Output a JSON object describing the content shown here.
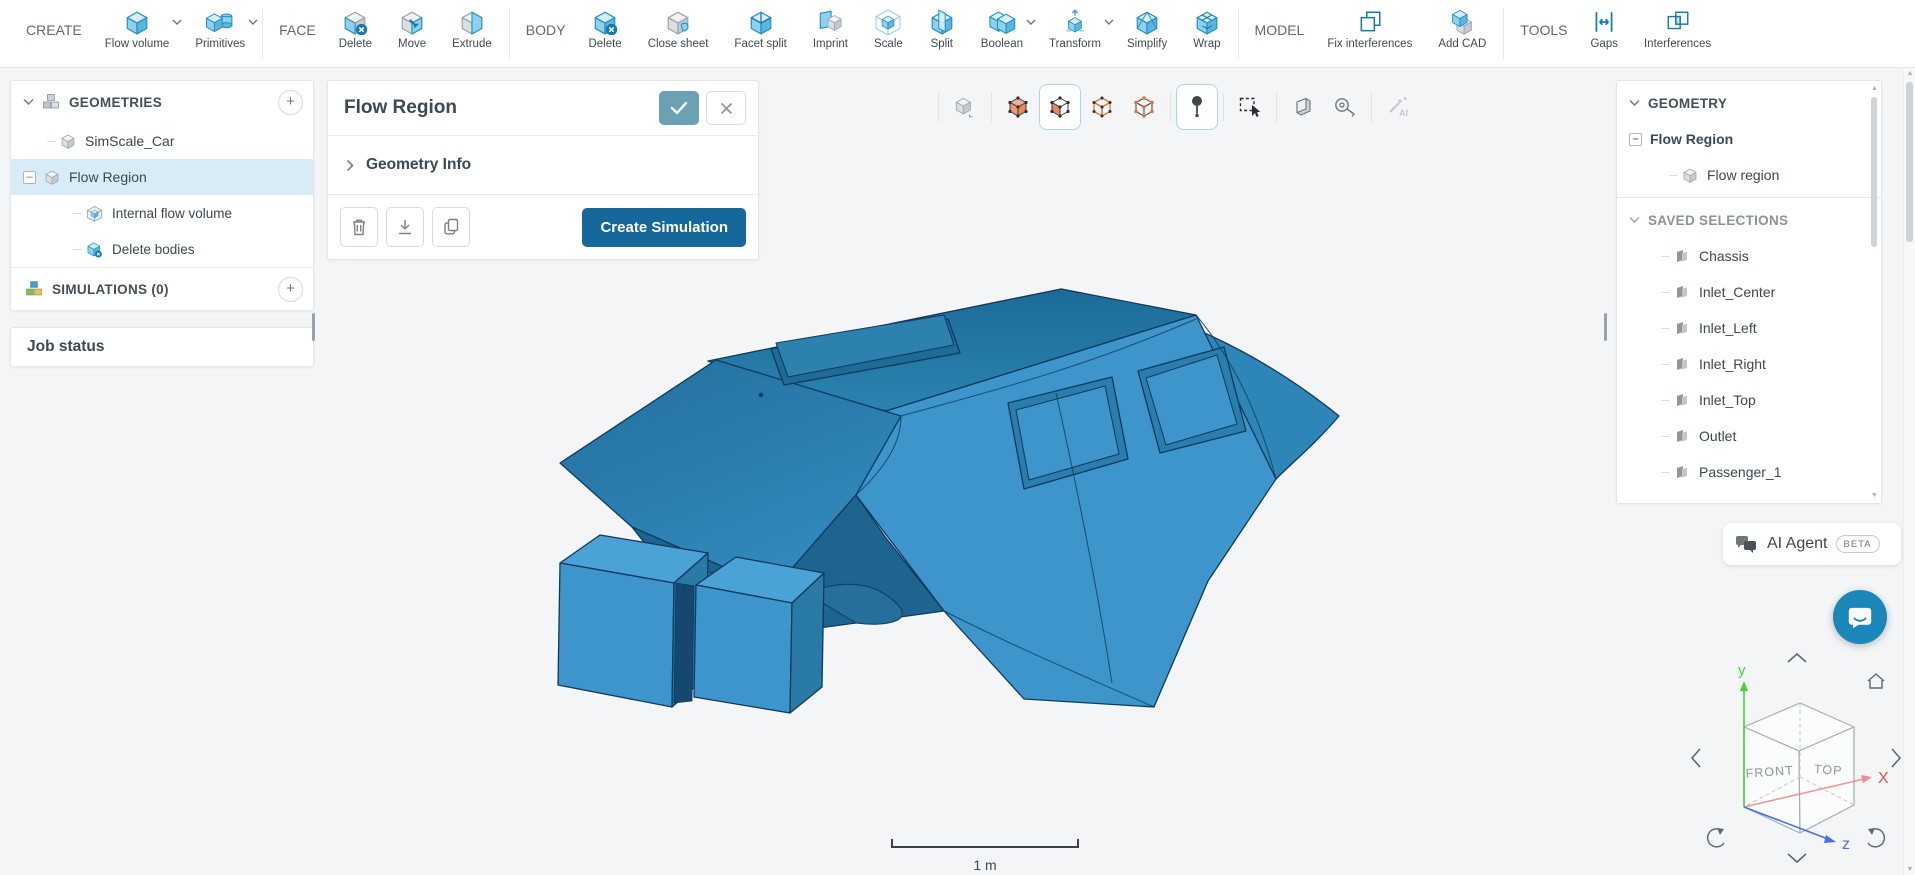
{
  "toolbar": {
    "create": {
      "label": "CREATE",
      "items": [
        {
          "label": "Flow volume",
          "icon": "flow-volume-icon",
          "dropdown": true
        },
        {
          "label": "Primitives",
          "icon": "primitives-icon",
          "dropdown": true
        }
      ]
    },
    "face": {
      "label": "FACE",
      "items": [
        {
          "label": "Delete",
          "icon": "face-delete-icon"
        },
        {
          "label": "Move",
          "icon": "face-move-icon"
        },
        {
          "label": "Extrude",
          "icon": "face-extrude-icon"
        }
      ]
    },
    "body": {
      "label": "BODY",
      "items": [
        {
          "label": "Delete",
          "icon": "body-delete-icon"
        },
        {
          "label": "Close sheet",
          "icon": "close-sheet-icon"
        },
        {
          "label": "Facet split",
          "icon": "facet-split-icon"
        },
        {
          "label": "Imprint",
          "icon": "imprint-icon"
        },
        {
          "label": "Scale",
          "icon": "scale-icon"
        },
        {
          "label": "Split",
          "icon": "split-icon"
        },
        {
          "label": "Boolean",
          "icon": "boolean-icon",
          "dropdown": true
        },
        {
          "label": "Transform",
          "icon": "transform-icon",
          "dropdown": true
        },
        {
          "label": "Simplify",
          "icon": "simplify-icon"
        },
        {
          "label": "Wrap",
          "icon": "wrap-icon"
        }
      ]
    },
    "model": {
      "label": "MODEL",
      "items": [
        {
          "label": "Fix interferences",
          "icon": "fix-interferences-icon"
        },
        {
          "label": "Add CAD",
          "icon": "add-cad-icon"
        }
      ]
    },
    "tools": {
      "label": "TOOLS",
      "items": [
        {
          "label": "Gaps",
          "icon": "gaps-icon"
        },
        {
          "label": "Interferences",
          "icon": "interferences-icon"
        }
      ]
    }
  },
  "left_panel": {
    "geometries": {
      "label": "GEOMETRIES",
      "items": [
        {
          "label": "SimScale_Car"
        },
        {
          "label": "Flow Region",
          "selected": true,
          "children": [
            {
              "label": "Internal flow volume",
              "icon": "flow-volume-cube-icon"
            },
            {
              "label": "Delete bodies",
              "icon": "delete-cube-icon"
            }
          ]
        }
      ]
    },
    "simulations": {
      "label": "SIMULATIONS (0)"
    },
    "job_status": {
      "label": "Job status"
    }
  },
  "detail_panel": {
    "title": "Flow Region",
    "sections": [
      {
        "label": "Geometry Info"
      }
    ],
    "actions": {
      "create_simulation": "Create Simulation"
    }
  },
  "viewport": {
    "scale_bar": {
      "label": "1 m"
    },
    "nav_cube": {
      "faces": {
        "left": "FRONT",
        "right": "TOP"
      },
      "axes": {
        "x": "X",
        "y": "y",
        "z": "z"
      }
    },
    "tool_modes": {
      "active": [
        "face-select",
        "probe-point"
      ]
    }
  },
  "right_panel": {
    "geometry": {
      "label": "GEOMETRY",
      "root": {
        "label": "Flow Region"
      },
      "child": {
        "label": "Flow region"
      }
    },
    "saved_selections": {
      "label": "SAVED SELECTIONS",
      "items": [
        "Chassis",
        "Inlet_Center",
        "Inlet_Left",
        "Inlet_Right",
        "Inlet_Top",
        "Outlet",
        "Passenger_1"
      ]
    }
  },
  "ai_agent": {
    "label": "AI Agent",
    "badge": "BETA"
  },
  "colors": {
    "primary_button": "#16689b",
    "accent_check": "#6ba1b5",
    "selection_bg": "#d8ecf7",
    "icon_blue": "#2391c3",
    "viewport_bg": "#f4f5f6",
    "model_blue": "#3e95cc",
    "active_border": "#aed4e8",
    "intercom_blue": "#1b86b8",
    "axis_x": "#e05252",
    "axis_y": "#44d62c",
    "axis_z": "#4a6cf0"
  }
}
